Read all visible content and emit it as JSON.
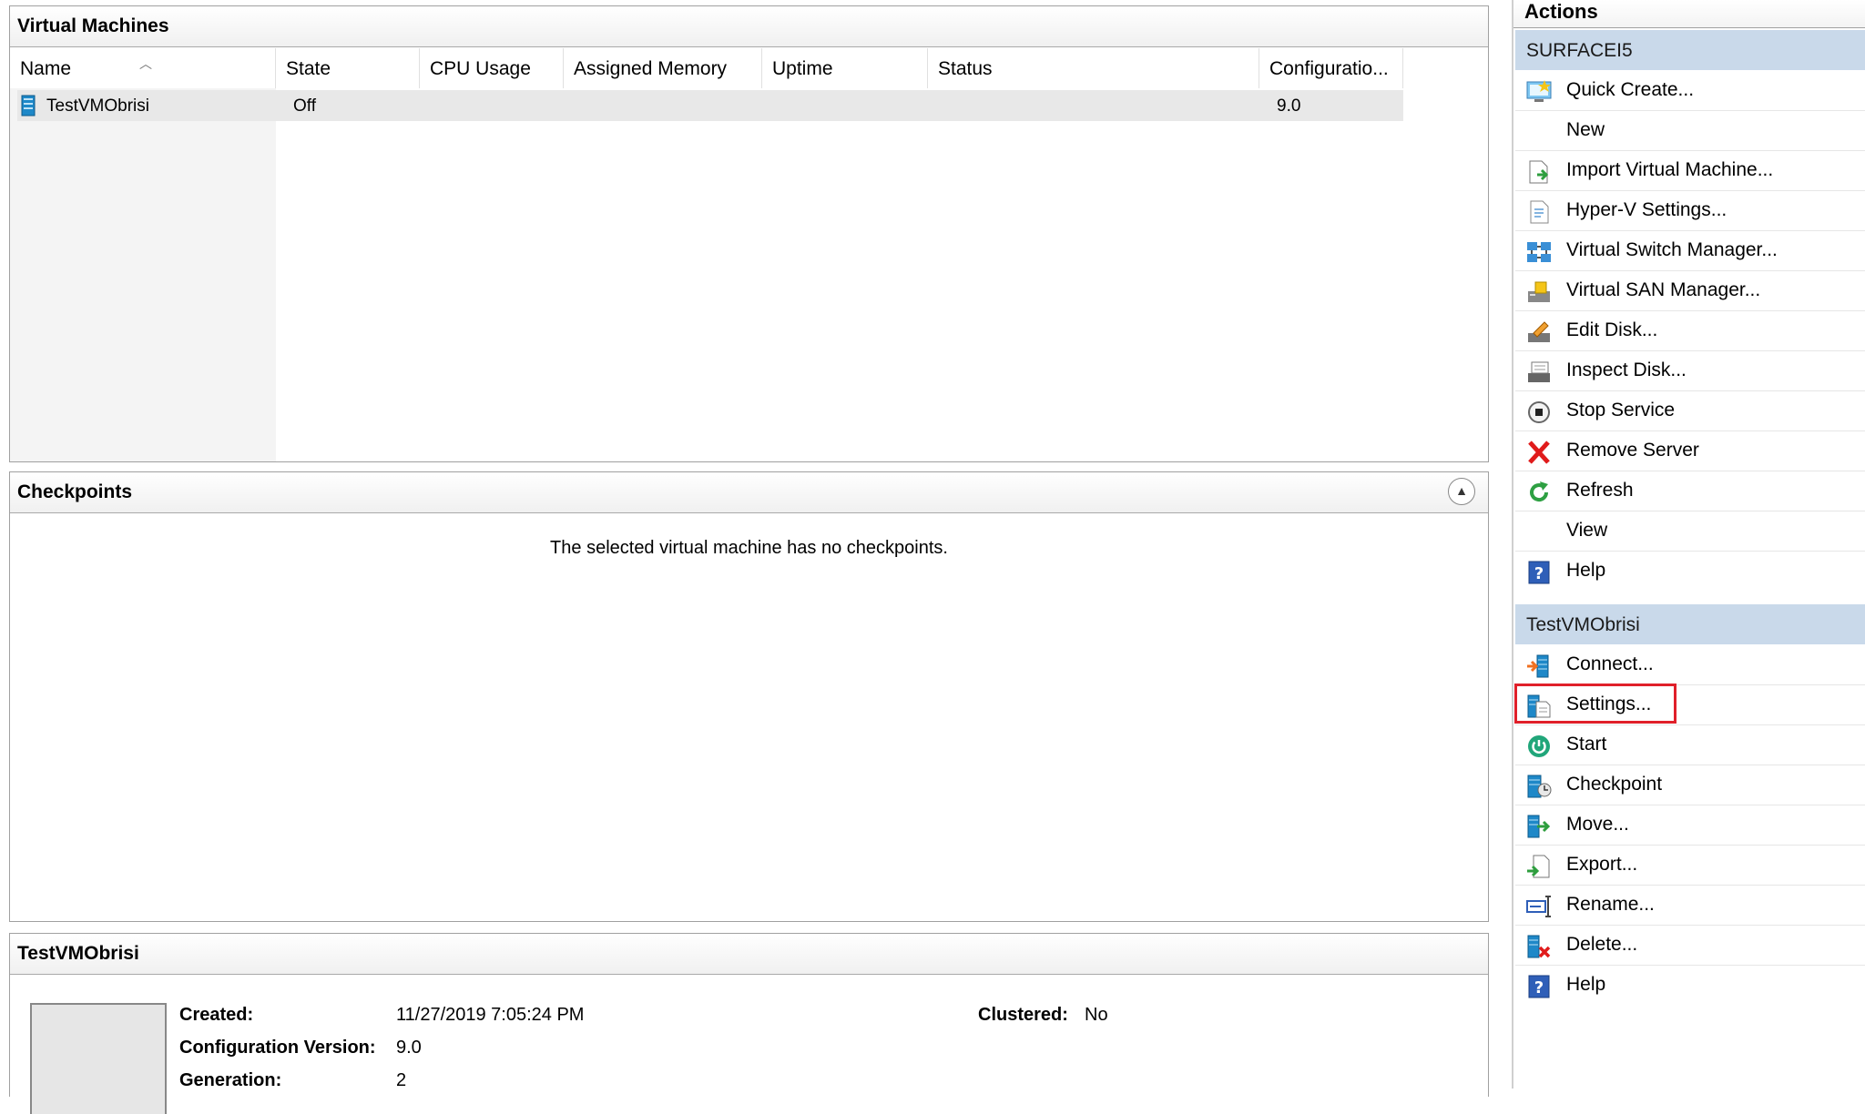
{
  "vm_panel": {
    "title": "Virtual Machines",
    "columns": [
      "Name",
      "State",
      "CPU Usage",
      "Assigned Memory",
      "Uptime",
      "Status",
      "Configuratio..."
    ],
    "rows": [
      {
        "name": "TestVMObrisi",
        "state": "Off",
        "cpu": "",
        "memory": "",
        "uptime": "",
        "status": "",
        "config": "9.0"
      }
    ]
  },
  "checkpoints": {
    "title": "Checkpoints",
    "message": "The selected virtual machine has no checkpoints."
  },
  "details": {
    "title": "TestVMObrisi",
    "created_label": "Created:",
    "created_value": "11/27/2019 7:05:24 PM",
    "config_label": "Configuration Version:",
    "config_value": "9.0",
    "gen_label": "Generation:",
    "gen_value": "2",
    "clustered_label": "Clustered:",
    "clustered_value": "No"
  },
  "actions": {
    "title": "Actions",
    "server_group": "SURFACEI5",
    "server_items": [
      {
        "label": "Quick Create...",
        "icon": "quick-create-icon"
      },
      {
        "label": "New",
        "icon": ""
      },
      {
        "label": "Import Virtual Machine...",
        "icon": "import-icon"
      },
      {
        "label": "Hyper-V Settings...",
        "icon": "hyperv-settings-icon"
      },
      {
        "label": "Virtual Switch Manager...",
        "icon": "switch-manager-icon"
      },
      {
        "label": "Virtual SAN Manager...",
        "icon": "san-manager-icon"
      },
      {
        "label": "Edit Disk...",
        "icon": "edit-disk-icon"
      },
      {
        "label": "Inspect Disk...",
        "icon": "inspect-disk-icon"
      },
      {
        "label": "Stop Service",
        "icon": "stop-icon"
      },
      {
        "label": "Remove Server",
        "icon": "remove-icon"
      },
      {
        "label": "Refresh",
        "icon": "refresh-icon"
      },
      {
        "label": "View",
        "icon": ""
      },
      {
        "label": "Help",
        "icon": "help-icon"
      }
    ],
    "vm_group": "TestVMObrisi",
    "vm_items": [
      {
        "label": "Connect...",
        "icon": "connect-icon"
      },
      {
        "label": "Settings...",
        "icon": "settings-icon"
      },
      {
        "label": "Start",
        "icon": "start-icon"
      },
      {
        "label": "Checkpoint",
        "icon": "checkpoint-icon"
      },
      {
        "label": "Move...",
        "icon": "move-icon"
      },
      {
        "label": "Export...",
        "icon": "export-icon"
      },
      {
        "label": "Rename...",
        "icon": "rename-icon"
      },
      {
        "label": "Delete...",
        "icon": "delete-icon"
      },
      {
        "label": "Help",
        "icon": "help-icon"
      }
    ]
  },
  "colors": {
    "group_header": "#c9d9ea",
    "highlight": "#e0202a"
  }
}
